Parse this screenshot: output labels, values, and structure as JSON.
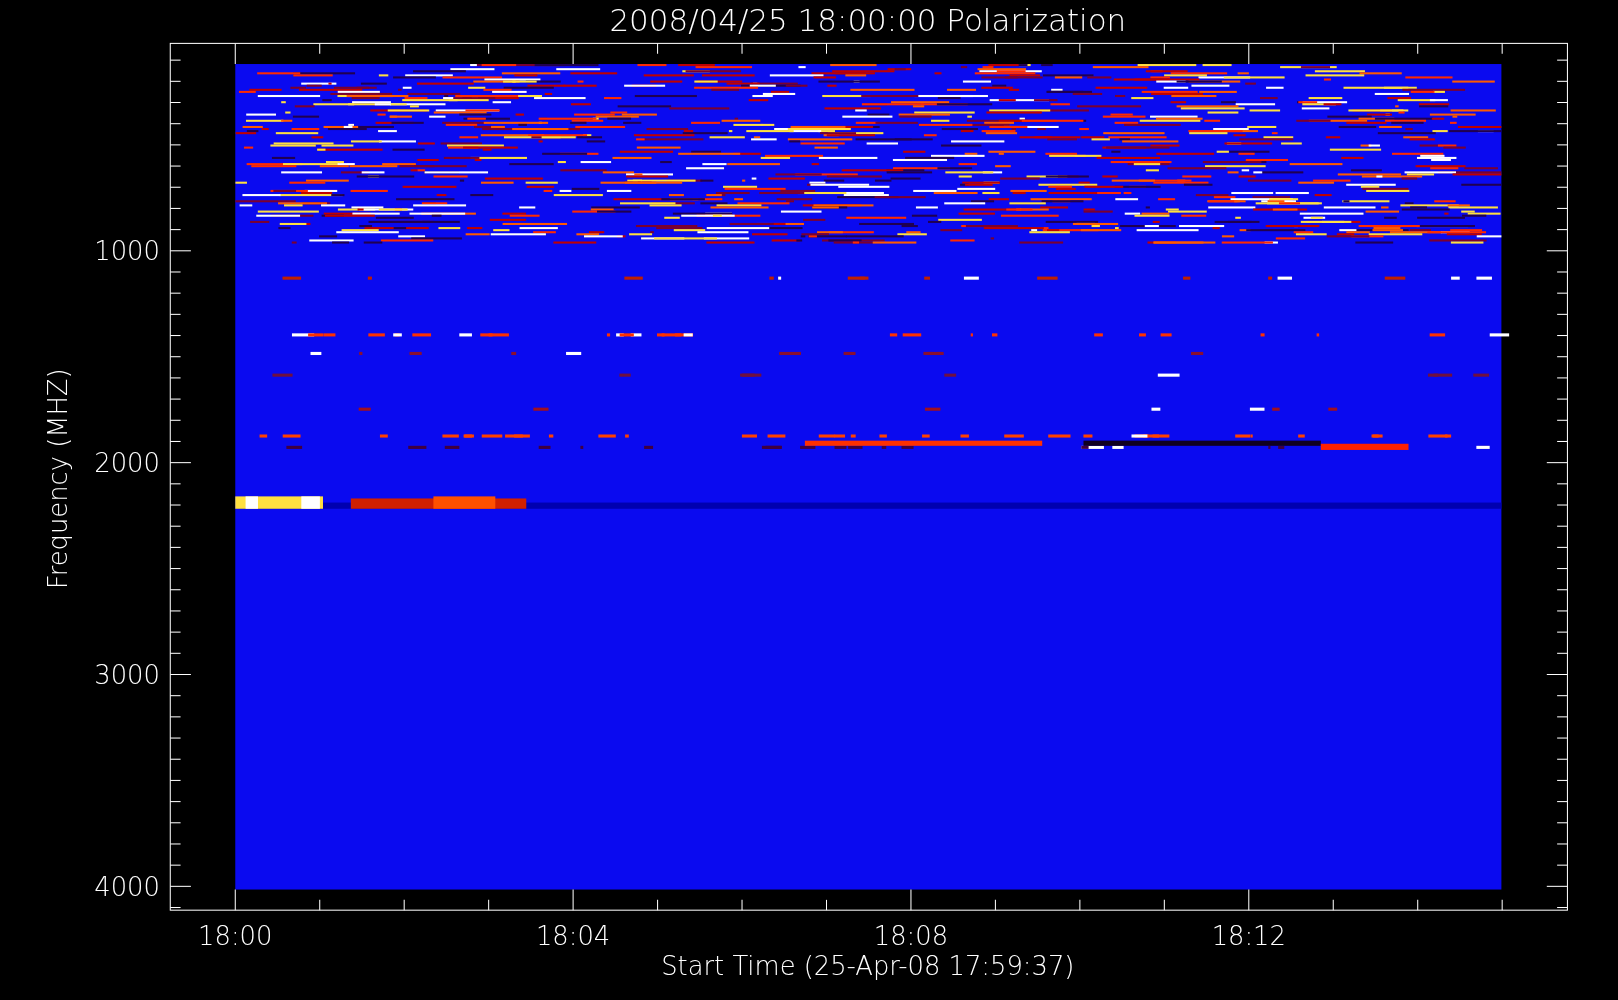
{
  "title": "2008/04/25 18:00:00 Polarization",
  "xlabel": "Start Time (25-Apr-08 17:59:37)",
  "ylabel": "Frequency (MHZ)",
  "xticks": [
    "18:00",
    "18:04",
    "18:08",
    "18:12"
  ],
  "yticks": [
    "1000",
    "2000",
    "3000",
    "4000"
  ]
}
